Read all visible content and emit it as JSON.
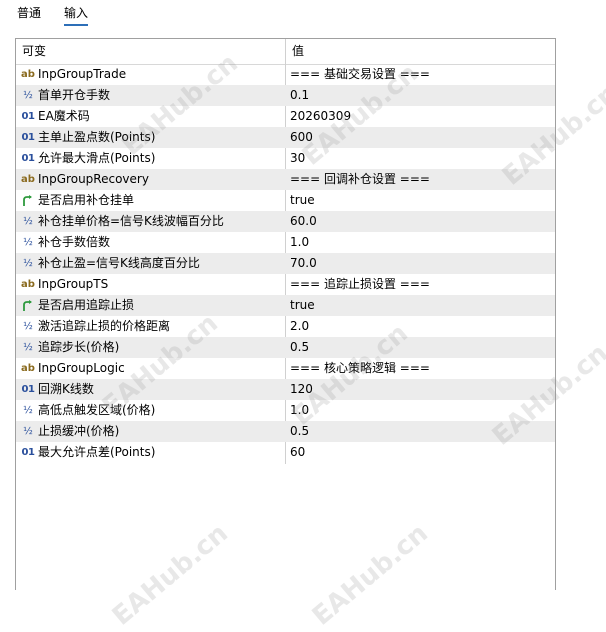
{
  "tabs": [
    {
      "label": "普通",
      "active": false
    },
    {
      "label": "输入",
      "active": true
    }
  ],
  "grid": {
    "headers": {
      "variable": "可变",
      "value": "值"
    },
    "rows": [
      {
        "icon": "ab",
        "name": "InpGroupTrade",
        "value": "=== 基础交易设置 ==="
      },
      {
        "icon": "half",
        "name": "首单开仓手数",
        "value": "0.1"
      },
      {
        "icon": "01",
        "name": "EA魔术码",
        "value": "20260309"
      },
      {
        "icon": "01",
        "name": "主单止盈点数(Points)",
        "value": "600"
      },
      {
        "icon": "01",
        "name": "允许最大滑点(Points)",
        "value": "30"
      },
      {
        "icon": "ab",
        "name": "InpGroupRecovery",
        "value": "=== 回调补仓设置 ==="
      },
      {
        "icon": "bool",
        "name": "是否启用补仓挂单",
        "value": "true"
      },
      {
        "icon": "half",
        "name": "补仓挂单价格=信号K线波幅百分比",
        "value": "60.0"
      },
      {
        "icon": "half",
        "name": "补仓手数倍数",
        "value": "1.0"
      },
      {
        "icon": "half",
        "name": "补仓止盈=信号K线高度百分比",
        "value": "70.0"
      },
      {
        "icon": "ab",
        "name": "InpGroupTS",
        "value": "=== 追踪止损设置 ==="
      },
      {
        "icon": "bool",
        "name": "是否启用追踪止损",
        "value": "true"
      },
      {
        "icon": "half",
        "name": "激活追踪止损的价格距离",
        "value": "2.0"
      },
      {
        "icon": "half",
        "name": "追踪步长(价格)",
        "value": "0.5"
      },
      {
        "icon": "ab",
        "name": "InpGroupLogic",
        "value": "=== 核心策略逻辑 ==="
      },
      {
        "icon": "01",
        "name": "回溯K线数",
        "value": "120"
      },
      {
        "icon": "half",
        "name": "高低点触发区域(价格)",
        "value": "1.0"
      },
      {
        "icon": "half",
        "name": "止损缓冲(价格)",
        "value": "0.5"
      },
      {
        "icon": "01",
        "name": "最大允许点差(Points)",
        "value": "60"
      }
    ]
  },
  "icon_names": {
    "ab": "string-type-icon",
    "half": "double-type-icon",
    "01": "integer-type-icon",
    "bool": "bool-type-icon"
  },
  "icon_glyphs": {
    "ab": "ab",
    "half": "½",
    "01": "01"
  },
  "watermark": "EAHub.cn",
  "colors": {
    "tab_underline": "#2d6fb8",
    "alt_row": "#ececec",
    "bool_icon": "#2e9a3e"
  }
}
